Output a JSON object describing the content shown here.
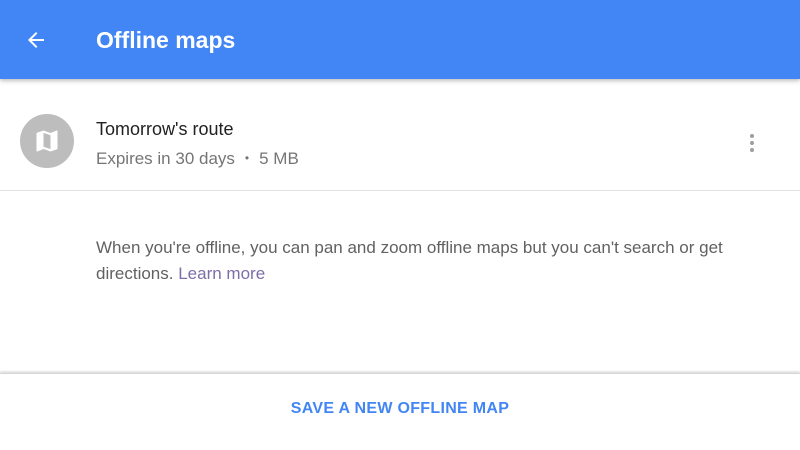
{
  "app_bar": {
    "title": "Offline maps",
    "back_icon": "arrow-back-icon",
    "background_color": "#4285f4"
  },
  "offline_map": {
    "icon": "map-icon",
    "name": "Tomorrow's route",
    "expiry": "Expires in 30 days",
    "separator": "•",
    "size": "5 MB",
    "menu_icon": "more-vert-icon"
  },
  "info": {
    "text": "When you're offline, you can pan and zoom offline maps but you can't search or get directions.",
    "link_label": "Learn more",
    "link_color": "#7e6ea8"
  },
  "footer": {
    "action_label": "SAVE A NEW OFFLINE MAP",
    "action_color": "#4285f4"
  }
}
